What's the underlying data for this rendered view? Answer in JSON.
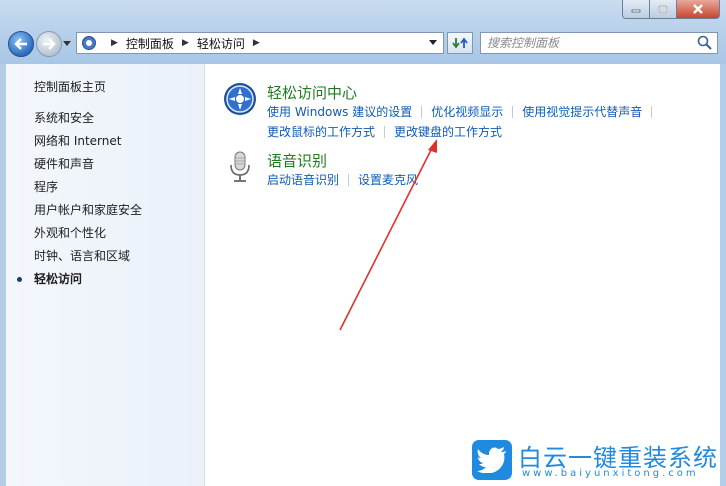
{
  "window": {
    "caption_buttons": {
      "minimize": "minimize",
      "maximize": "maximize",
      "close": "close"
    }
  },
  "address": {
    "crumbs": [
      "控制面板",
      "轻松访问"
    ]
  },
  "search": {
    "placeholder": "搜索控制面板"
  },
  "sidebar": {
    "home": "控制面板主页",
    "items": [
      {
        "label": "系统和安全",
        "active": false
      },
      {
        "label": "网络和 Internet",
        "active": false
      },
      {
        "label": "硬件和声音",
        "active": false
      },
      {
        "label": "程序",
        "active": false
      },
      {
        "label": "用户帐户和家庭安全",
        "active": false
      },
      {
        "label": "外观和个性化",
        "active": false
      },
      {
        "label": "时钟、语言和区域",
        "active": false
      },
      {
        "label": "轻松访问",
        "active": true
      }
    ]
  },
  "categories": [
    {
      "title": "轻松访问中心",
      "icon": "ease-of-access-icon",
      "links": [
        "使用 Windows 建议的设置",
        "优化视频显示",
        "使用视觉提示代替声音",
        "更改鼠标的工作方式",
        "更改键盘的工作方式"
      ]
    },
    {
      "title": "语音识别",
      "icon": "microphone-icon",
      "links": [
        "启动语音识别",
        "设置麦克风"
      ]
    }
  ],
  "watermark": {
    "title": "白云一键重装系统",
    "url": "www.baiyunxitong.com"
  },
  "colors": {
    "link": "#0f5bb5",
    "category_title": "#1f7b1f",
    "annotation_arrow": "#e0302a",
    "watermark": "#1f8ae0"
  }
}
